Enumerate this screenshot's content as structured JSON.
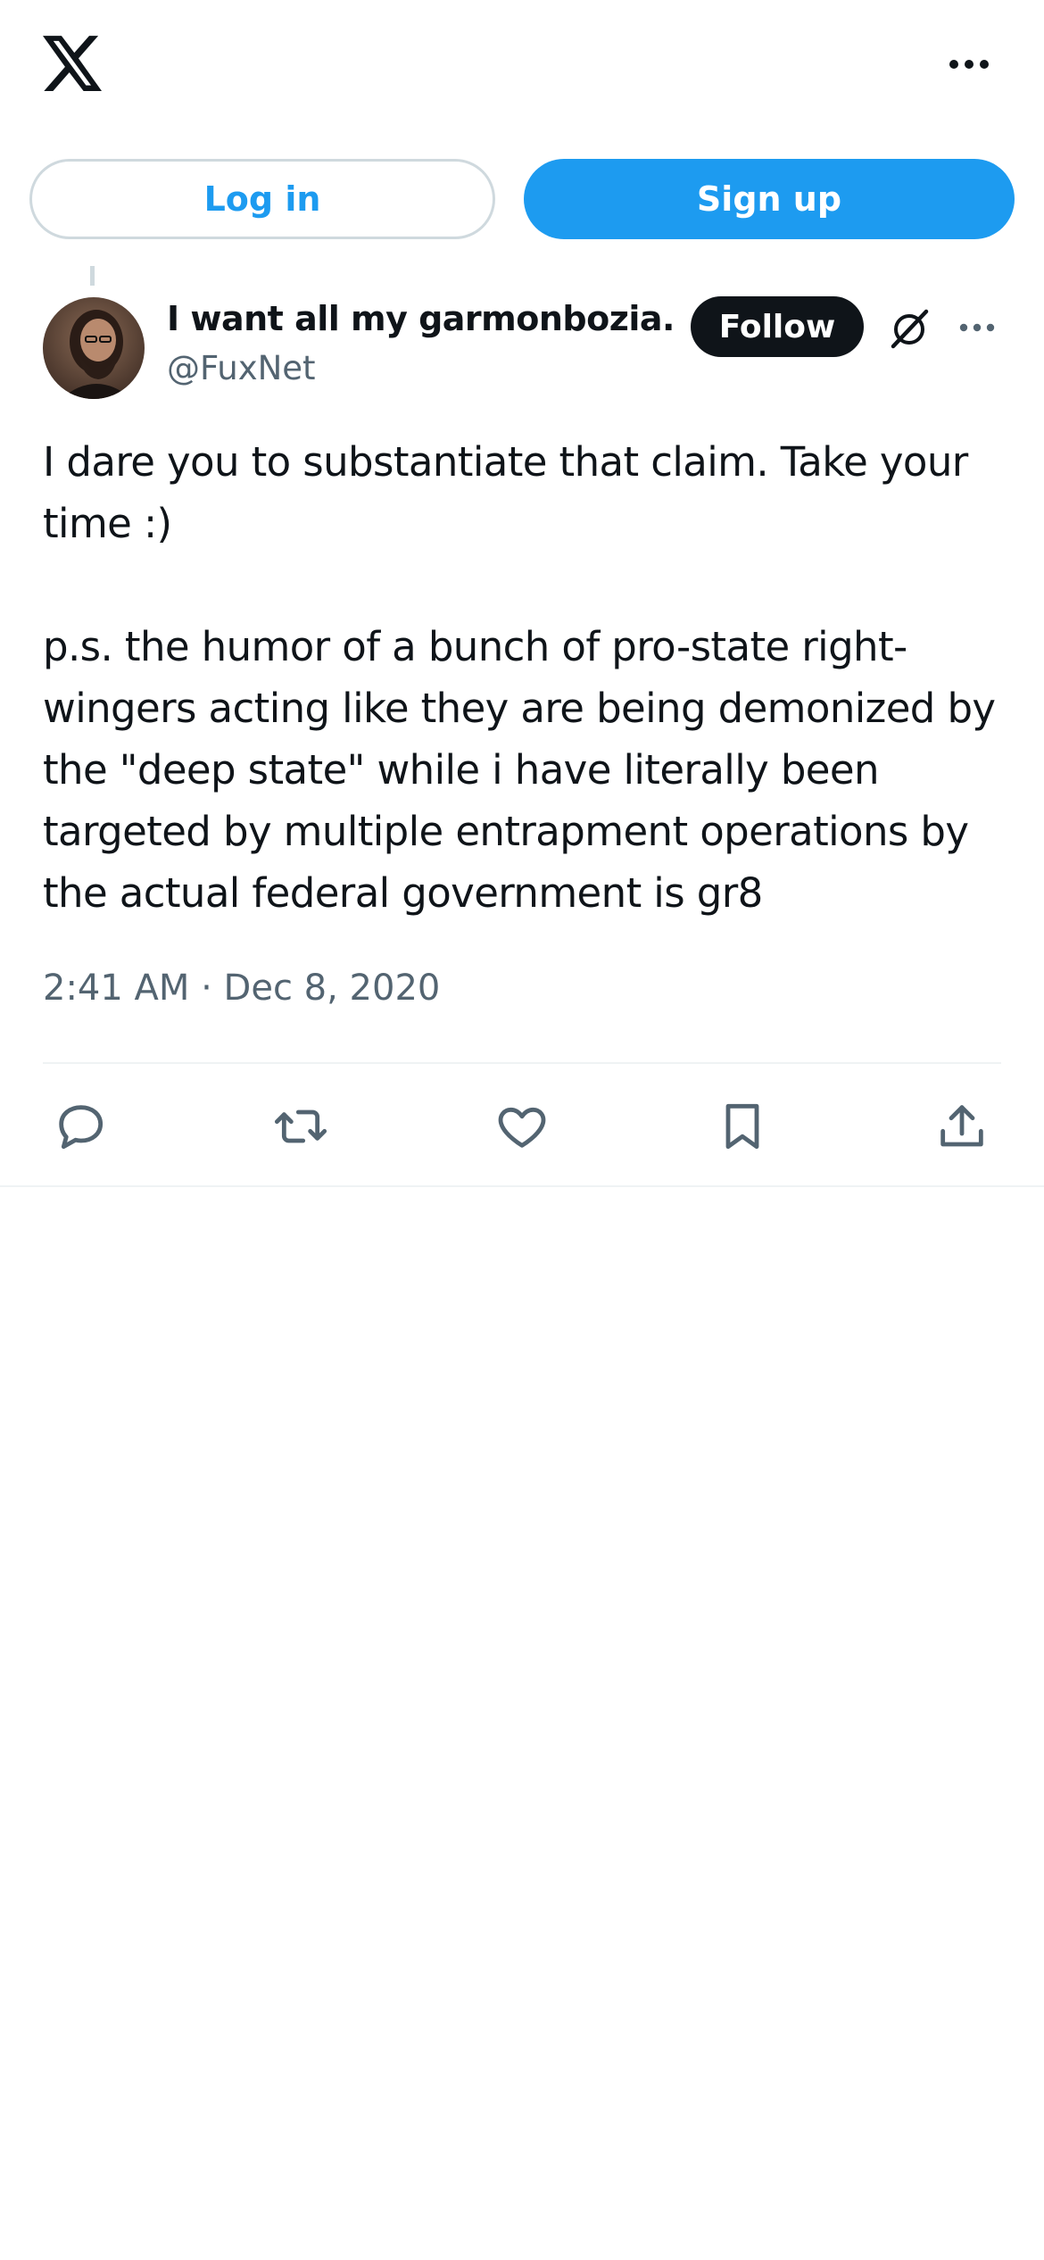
{
  "topbar": {
    "logo_icon": "x-logo-icon",
    "more_icon": "more-horizontal-icon"
  },
  "auth": {
    "login_label": "Log in",
    "signup_label": "Sign up"
  },
  "tweet": {
    "author": {
      "display_name": "I want all my garmonbozia.",
      "handle": "@FuxNet",
      "avatar_icon": "avatar"
    },
    "follow_label": "Follow",
    "grok_icon": "grok-icon",
    "more_icon": "more-horizontal-icon",
    "text": "I dare you to substantiate that claim. Take your\ntime :)\n\np.s. the humor of a bunch of pro-state right-\nwingers acting like they are being demonized by\nthe \"deep state\" while i have literally been\ntargeted by multiple entrapment operations by\nthe actual federal government is gr8",
    "timestamp": "2:41 AM · Dec 8, 2020",
    "actions": [
      {
        "name": "reply",
        "icon": "reply-icon"
      },
      {
        "name": "repost",
        "icon": "repost-icon"
      },
      {
        "name": "like",
        "icon": "like-icon"
      },
      {
        "name": "bookmark",
        "icon": "bookmark-icon"
      },
      {
        "name": "share",
        "icon": "share-icon"
      }
    ]
  },
  "colors": {
    "accent": "#1d9bf0",
    "text_primary": "#0f1419",
    "text_secondary": "#536471",
    "border": "#cfd9de",
    "divider": "#eff3f4"
  }
}
